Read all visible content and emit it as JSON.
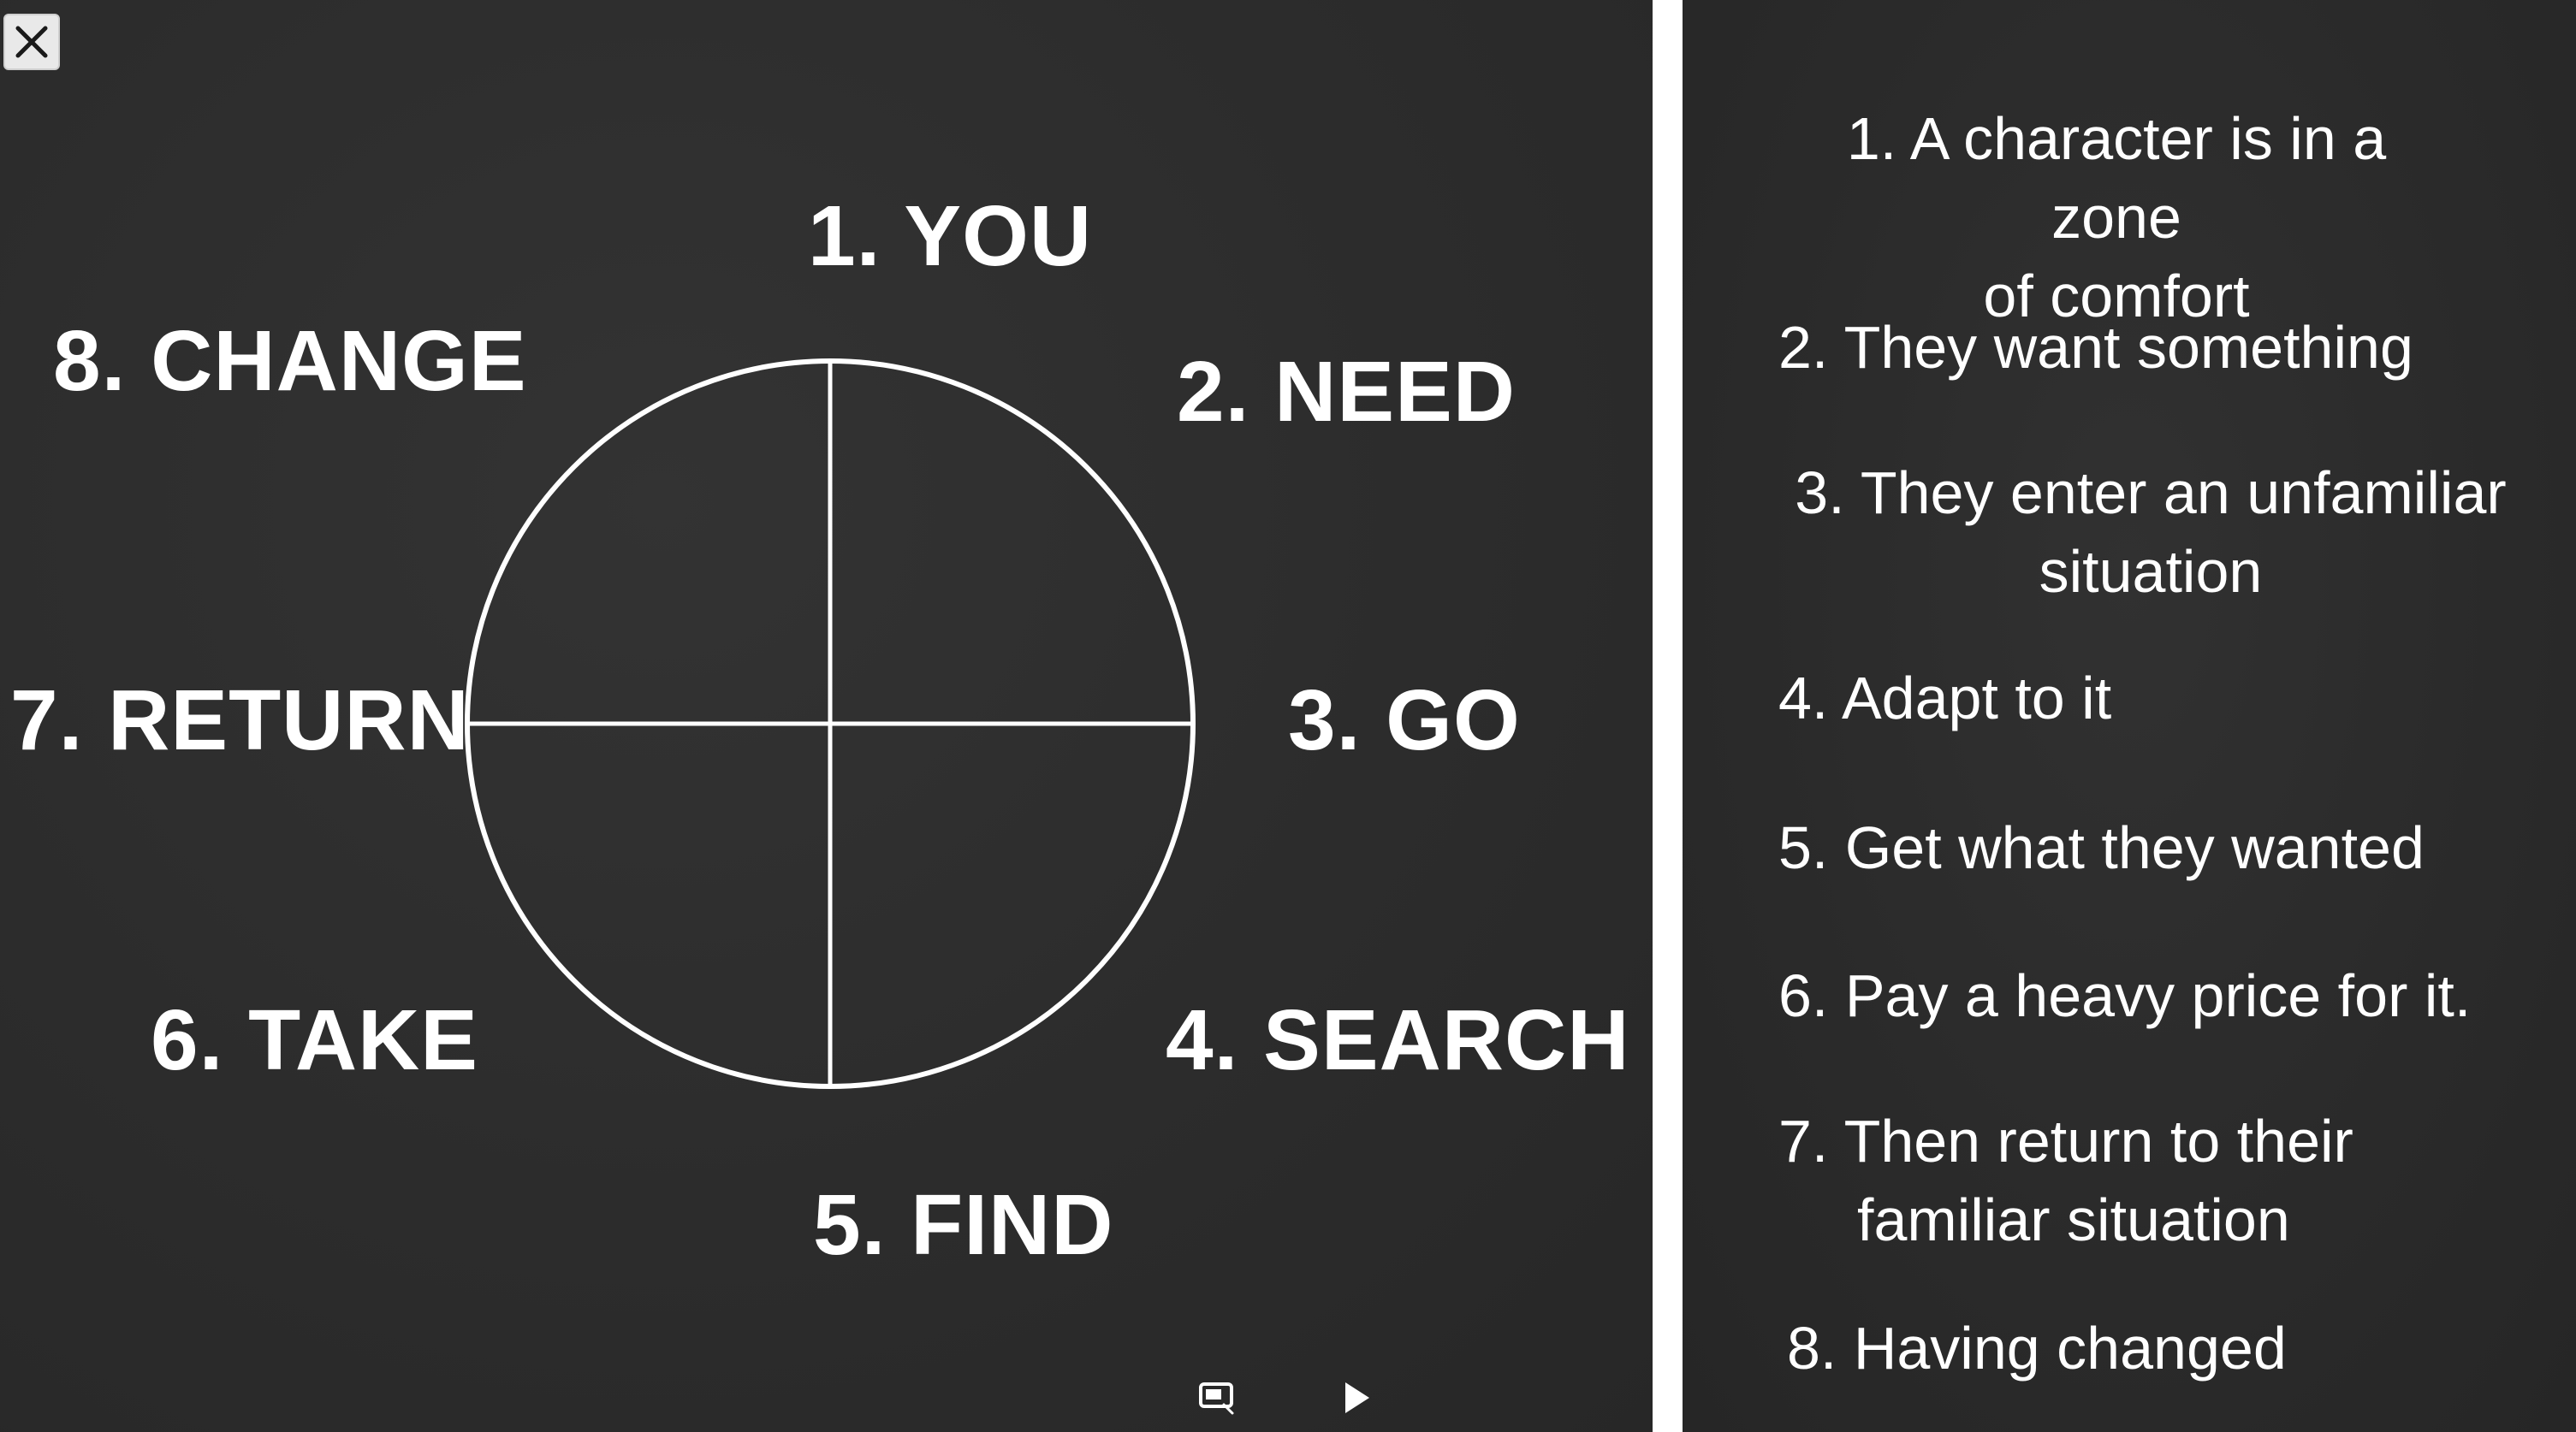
{
  "viewer": {
    "close_icon": "close-icon",
    "cast_icon": "screen-cast-icon",
    "play_icon": "play-icon"
  },
  "wheel": {
    "steps": [
      {
        "label": "1. YOU"
      },
      {
        "label": "2. NEED"
      },
      {
        "label": "3. GO"
      },
      {
        "label": "4. SEARCH"
      },
      {
        "label": "5. FIND"
      },
      {
        "label": "6. TAKE"
      },
      {
        "label": "7. RETURN"
      },
      {
        "label": "8. CHANGE"
      }
    ]
  },
  "descriptions": [
    {
      "line1": "1. A character is in a zone",
      "line2": "of comfort"
    },
    {
      "line1": "2. They want something",
      "line2": ""
    },
    {
      "line1": "3. They enter an unfamiliar",
      "line2": "situation"
    },
    {
      "line1": "4. Adapt to it",
      "line2": ""
    },
    {
      "line1": "5. Get what they wanted",
      "line2": ""
    },
    {
      "line1": "6. Pay a heavy price for it.",
      "line2": ""
    },
    {
      "line1": "7. Then return to their",
      "line2": "familiar situation"
    },
    {
      "line1": "8. Having changed",
      "line2": ""
    }
  ],
  "colors": {
    "background": "#2b2b2b",
    "foreground": "#ffffff",
    "divider": "#ffffff"
  }
}
